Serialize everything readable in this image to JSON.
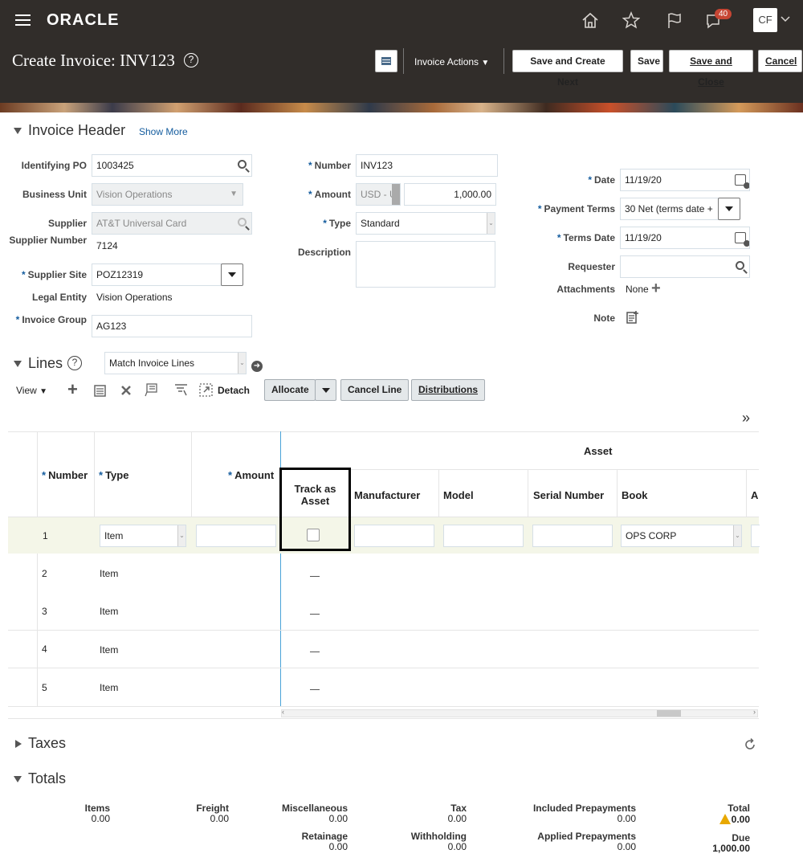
{
  "header": {
    "logo": "ORACLE",
    "notifications_count": "40",
    "user_initials": "CF",
    "page_title": "Create Invoice: INV123",
    "help": "?",
    "invoice_actions": "Invoice Actions",
    "save_create_next": "Save and Create Next",
    "save": "Save",
    "save_close": "Save and Close",
    "cancel": "Cancel"
  },
  "invoice_header": {
    "title": "Invoice Header",
    "show_more": "Show More",
    "identifying_po": {
      "label": "Identifying PO",
      "value": "1003425"
    },
    "business_unit": {
      "label": "Business Unit",
      "value": "Vision Operations"
    },
    "supplier": {
      "label": "Supplier",
      "value": "AT&T Universal Card"
    },
    "supplier_number": {
      "label": "Supplier Number",
      "value": "7124"
    },
    "supplier_site": {
      "label": "Supplier Site",
      "value": "POZ12319"
    },
    "legal_entity": {
      "label": "Legal Entity",
      "value": "Vision Operations"
    },
    "invoice_group": {
      "label": "Invoice Group",
      "value": "AG123"
    },
    "number": {
      "label": "Number",
      "value": "INV123"
    },
    "amount": {
      "label": "Amount",
      "currency": "USD - U",
      "value": "1,000.00"
    },
    "type": {
      "label": "Type",
      "value": "Standard"
    },
    "description": {
      "label": "Description",
      "value": ""
    },
    "date": {
      "label": "Date",
      "value": "11/19/20"
    },
    "payment_terms": {
      "label": "Payment Terms",
      "value": "30 Net (terms date +"
    },
    "terms_date": {
      "label": "Terms Date",
      "value": "11/19/20"
    },
    "requester": {
      "label": "Requester",
      "value": ""
    },
    "attachments": {
      "label": "Attachments",
      "value": "None"
    },
    "note": {
      "label": "Note"
    }
  },
  "lines": {
    "title": "Lines",
    "match_select": "Match Invoice Lines",
    "view": "View",
    "detach": "Detach",
    "allocate": "Allocate",
    "cancel_line": "Cancel Line",
    "distributions": "Distributions",
    "columns": {
      "number": "Number",
      "type": "Type",
      "amount": "Amount",
      "asset_group": "Asset",
      "track_as_asset": "Track as Asset",
      "manufacturer": "Manufacturer",
      "model": "Model",
      "serial_number": "Serial Number",
      "book": "Book",
      "next": "A"
    },
    "rows": [
      {
        "number": "1",
        "type": "Item",
        "book": "OPS CORP"
      },
      {
        "number": "2",
        "type": "Item"
      },
      {
        "number": "3",
        "type": "Item"
      },
      {
        "number": "4",
        "type": "Item"
      },
      {
        "number": "5",
        "type": "Item"
      }
    ]
  },
  "taxes": {
    "title": "Taxes"
  },
  "totals": {
    "title": "Totals",
    "items": {
      "label": "Items",
      "value": "0.00"
    },
    "freight": {
      "label": "Freight",
      "value": "0.00"
    },
    "miscellaneous": {
      "label": "Miscellaneous",
      "value": "0.00"
    },
    "tax": {
      "label": "Tax",
      "value": "0.00"
    },
    "included_prepayments": {
      "label": "Included Prepayments",
      "value": "0.00"
    },
    "total": {
      "label": "Total",
      "value": "0.00"
    },
    "retainage": {
      "label": "Retainage",
      "value": "0.00"
    },
    "withholding": {
      "label": "Withholding",
      "value": "0.00"
    },
    "applied_prepayments": {
      "label": "Applied Prepayments",
      "value": "0.00"
    },
    "due": {
      "label": "Due",
      "value": "1,000.00"
    }
  },
  "colors": {
    "topbar": "#312d2a",
    "link": "#145c9e",
    "row_highlight": "#f4f6e8"
  }
}
